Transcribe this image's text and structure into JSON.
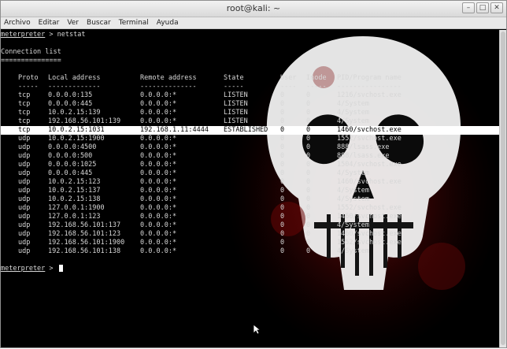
{
  "window": {
    "title": "root@kali: ~"
  },
  "menubar": [
    "Archivo",
    "Editar",
    "Ver",
    "Buscar",
    "Terminal",
    "Ayuda"
  ],
  "terminal": {
    "prompt": "meterpreter",
    "command": " > netstat",
    "heading": "Connection list",
    "heading_rule": "===============",
    "headers": [
      "Proto",
      "Local address",
      "Remote address",
      "State",
      "User",
      "Inode",
      "PID/Program name"
    ],
    "header_rules": [
      "-----",
      "-------------",
      "--------------",
      "-----",
      "----",
      "-----",
      "----------------"
    ],
    "connections": [
      [
        "tcp",
        "0.0.0.0:135",
        "0.0.0.0:*",
        "LISTEN",
        "0",
        "0",
        "1216/svchost.exe"
      ],
      [
        "tcp",
        "0.0.0.0:445",
        "0.0.0.0:*",
        "LISTEN",
        "0",
        "0",
        "4/System"
      ],
      [
        "tcp",
        "10.0.2.15:139",
        "0.0.0.0:*",
        "LISTEN",
        "0",
        "0",
        "4/System"
      ],
      [
        "tcp",
        "192.168.56.101:139",
        "0.0.0.0:*",
        "LISTEN",
        "0",
        "0",
        "4/System"
      ],
      [
        "tcp",
        "10.0.2.15:1031",
        "192.168.1.11:4444",
        "ESTABLISHED",
        "0",
        "0",
        "1460/svchost.exe"
      ],
      [
        "udp",
        "10.0.2.15:1900",
        "0.0.0.0:*",
        "",
        "0",
        "0",
        "1552/svchost.exe"
      ],
      [
        "udp",
        "0.0.0.0:4500",
        "0.0.0.0:*",
        "",
        "0",
        "0",
        "888/lsass.exe"
      ],
      [
        "udp",
        "0.0.0.0:500",
        "0.0.0.0:*",
        "",
        "0",
        "0",
        "888/lsass.exe"
      ],
      [
        "udp",
        "0.0.0.0:1025",
        "0.0.0.0:*",
        "",
        "0",
        "0",
        "1504/svchost.exe"
      ],
      [
        "udp",
        "0.0.0.0:445",
        "0.0.0.0:*",
        "",
        "0",
        "0",
        "4/System"
      ],
      [
        "udp",
        "10.0.2.15:123",
        "0.0.0.0:*",
        "",
        "0",
        "0",
        "1460/svchost.exe"
      ],
      [
        "udp",
        "10.0.2.15:137",
        "0.0.0.0:*",
        "",
        "0",
        "0",
        "4/System"
      ],
      [
        "udp",
        "10.0.2.15:138",
        "0.0.0.0:*",
        "",
        "0",
        "0",
        "4/System"
      ],
      [
        "udp",
        "127.0.0.1:1900",
        "0.0.0.0:*",
        "",
        "0",
        "0",
        "1552/svchost.exe"
      ],
      [
        "udp",
        "127.0.0.1:123",
        "0.0.0.0:*",
        "",
        "0",
        "0",
        "1460/svchost.exe"
      ],
      [
        "udp",
        "192.168.56.101:137",
        "0.0.0.0:*",
        "",
        "0",
        "0",
        "4/System"
      ],
      [
        "udp",
        "192.168.56.101:123",
        "0.0.0.0:*",
        "",
        "0",
        "0",
        "1460/svchost.exe"
      ],
      [
        "udp",
        "192.168.56.101:1900",
        "0.0.0.0:*",
        "",
        "0",
        "0",
        "1552/svchost.exe"
      ],
      [
        "udp",
        "192.168.56.101:138",
        "0.0.0.0:*",
        "",
        "0",
        "0",
        "4/System"
      ]
    ],
    "selected_index": 4,
    "final_prompt": "meterpreter",
    "final_prompt_suffix": " > "
  },
  "colors": {
    "terminal_bg": "#000000",
    "text": "#d7d7d7",
    "skull": "#f0f0f0",
    "blood": "#7a0a0a"
  },
  "icons": {
    "minimize": "minimize-icon",
    "maximize": "maximize-icon",
    "close": "close-icon",
    "pointer": "mouse-pointer-icon"
  }
}
